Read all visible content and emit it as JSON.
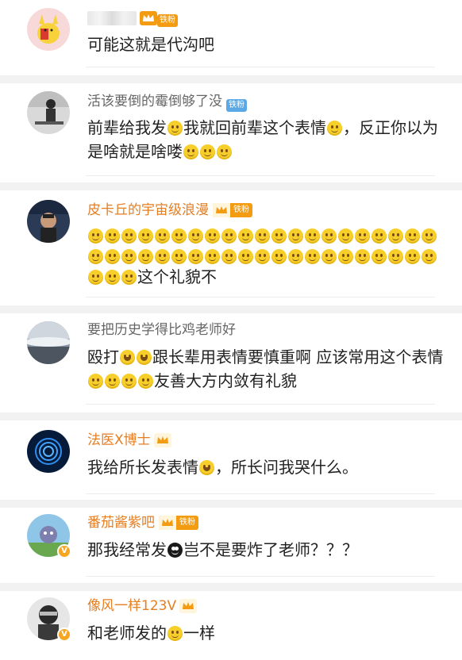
{
  "comments": [
    {
      "name": "",
      "name_blurred": true,
      "badge": "铁粉",
      "text": "可能这就是代沟吧"
    },
    {
      "name": "活该要倒的霉倒够了没",
      "badge": "铁粉",
      "text_parts": [
        "前辈给我发",
        "我就回前辈这个表情",
        "，反正你以为是啥就是啥喽"
      ]
    },
    {
      "name": "皮卡丘的宇宙级浪漫",
      "badge": "铁粉",
      "text_tail": "这个礼貌不"
    },
    {
      "name": "要把历史学得比鸡老师好",
      "text_parts": [
        "殴打",
        "跟长辈用表情要慎重啊 应该常用这个表情",
        "友善大方内敛有礼貌"
      ]
    },
    {
      "name": "法医X博士",
      "text_parts": [
        "我给所长发表情",
        "，所长问我哭什么。"
      ]
    },
    {
      "name": "番茄酱紫吧",
      "badge": "铁粉",
      "text_parts": [
        "那我经常发",
        "岂不是要炸了老师？？？"
      ]
    },
    {
      "name": "像风一样123V",
      "text_parts": [
        "和老师发的",
        "一样"
      ]
    }
  ],
  "icons": {
    "emoji_smile": "smile-emoji-icon",
    "emoji_laugh_cry": "laugh-cry-emoji-icon",
    "emoji_dark": "dark-face-emoji-icon",
    "crown": "crown-icon",
    "verified": "verified-v-icon"
  },
  "colors": {
    "accent_name": "#e67e22",
    "gray_name": "#666666",
    "badge_orange": "#f39c12",
    "badge_blue": "#5aa9e6",
    "verified": "#f5a623"
  }
}
